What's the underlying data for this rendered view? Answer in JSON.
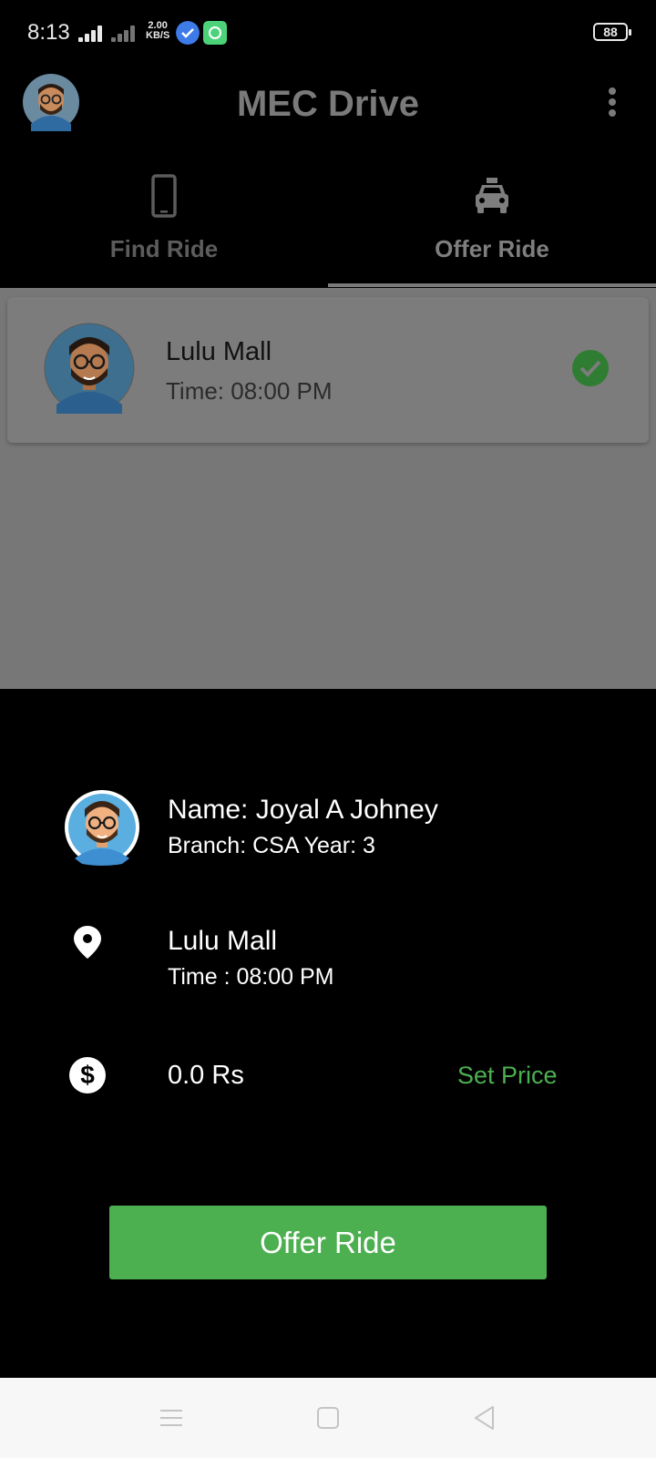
{
  "status_bar": {
    "time": "8:13",
    "speed_value": "2.00",
    "speed_unit": "KB/S",
    "battery": "88"
  },
  "toolbar": {
    "title": "MEC Drive",
    "avatar_icon": "user-avatar",
    "menu_icon": "more-vert-icon"
  },
  "tabs": [
    {
      "label": "Find Ride",
      "icon": "phone-icon",
      "active": false
    },
    {
      "label": "Offer Ride",
      "icon": "taxi-icon",
      "active": true
    }
  ],
  "ride_card": {
    "place": "Lulu Mall",
    "time": "Time: 08:00 PM",
    "status_icon": "check-circle-icon",
    "status_color": "#2e7d32"
  },
  "sheet": {
    "name": "Name: Joyal A Johney",
    "branch_year": "Branch: CSA  Year: 3",
    "place": "Lulu Mall",
    "time": "Time : 08:00 PM",
    "price": "0.0 Rs",
    "set_price_label": "Set Price",
    "offer_button_label": "Offer Ride"
  },
  "colors": {
    "accent_green": "#4caf50",
    "dim_overlay": "#777777",
    "background": "#000000"
  },
  "nav_bar": {
    "icons": [
      "menu-icon",
      "home-icon",
      "back-icon"
    ]
  }
}
